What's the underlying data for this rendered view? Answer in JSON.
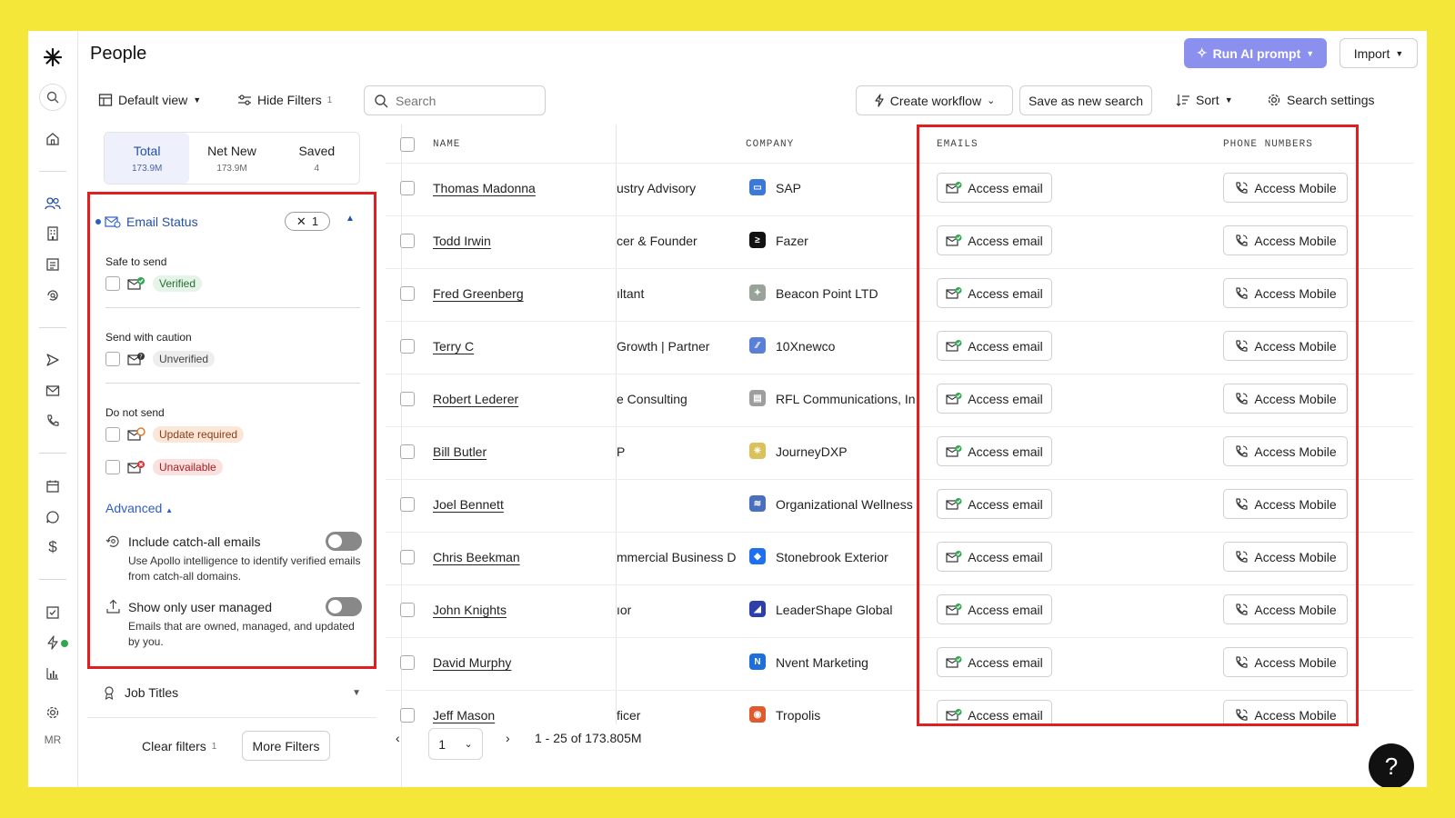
{
  "header": {
    "title": "People",
    "run_ai_label": "Run AI prompt",
    "import_label": "Import"
  },
  "toolbar": {
    "default_view": "Default view",
    "hide_filters": "Hide Filters",
    "hide_filters_count": "1",
    "search_placeholder": "Search",
    "create_workflow": "Create workflow",
    "save_search": "Save as new search",
    "sort": "Sort",
    "search_settings": "Search settings"
  },
  "rail": {
    "initials": "MR"
  },
  "tabs": [
    {
      "label": "Total",
      "count": "173.9M"
    },
    {
      "label": "Net New",
      "count": "173.9M"
    },
    {
      "label": "Saved",
      "count": "4"
    }
  ],
  "email_status": {
    "title": "Email Status",
    "selected_count": "1",
    "groups": {
      "safe": "Safe to send",
      "caution": "Send with caution",
      "donot": "Do not send"
    },
    "options": {
      "verified": "Verified",
      "unverified": "Unverified",
      "update_required": "Update required",
      "unavailable": "Unavailable"
    },
    "advanced": "Advanced",
    "catch_all_title": "Include catch-all emails",
    "catch_all_desc": "Use Apollo intelligence to identify verified emails from catch-all domains.",
    "user_managed_title": "Show only user managed",
    "user_managed_desc": "Emails that are owned, managed, and updated by you."
  },
  "filters_footer": {
    "job_titles": "Job Titles",
    "clear_filters": "Clear filters",
    "clear_count": "1",
    "more_filters": "More Filters"
  },
  "table": {
    "headers": {
      "name": "NAME",
      "company": "COMPANY",
      "emails": "EMAILS",
      "phones": "PHONE NUMBERS"
    },
    "email_label": "Access email",
    "mobile_label": "Access Mobile",
    "rows": [
      {
        "name": "Thomas Madonna",
        "title": "ustry Advisory",
        "company": "SAP"
      },
      {
        "name": "Todd Irwin",
        "title": "cer & Founder",
        "company": "Fazer"
      },
      {
        "name": "Fred Greenberg",
        "title": "ıltant",
        "company": "Beacon Point LTD"
      },
      {
        "name": "Terry C",
        "title": "Growth | Partner",
        "company": "10Xnewco"
      },
      {
        "name": "Robert Lederer",
        "title": "e Consulting",
        "company": "RFL Communications, In"
      },
      {
        "name": "Bill Butler",
        "title": "P",
        "company": "JourneyDXP"
      },
      {
        "name": "Joel Bennett",
        "title": "",
        "company": "Organizational Wellness"
      },
      {
        "name": "Chris Beekman",
        "title": "mmercial Business D",
        "company": "Stonebrook Exterior"
      },
      {
        "name": "John Knights",
        "title": "ıor",
        "company": "LeaderShape Global"
      },
      {
        "name": "David Murphy",
        "title": "",
        "company": "Nvent Marketing"
      },
      {
        "name": "Jeff Mason",
        "title": "ficer",
        "company": "Tropolis"
      }
    ]
  },
  "pagination": {
    "page": "1",
    "range": "1 - 25 of 173.805M"
  },
  "help_label": "?"
}
